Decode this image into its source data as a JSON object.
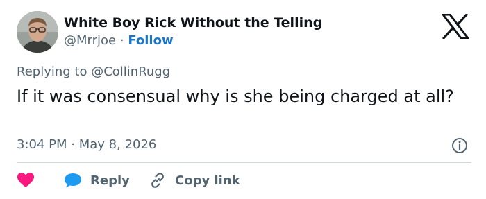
{
  "author": {
    "display_name": "White Boy Rick Without the Telling",
    "handle": "@Mrrjoe",
    "separator": "·",
    "follow_label": "Follow"
  },
  "tweet": {
    "replying_to": "Replying to @CollinRugg",
    "text": "If it was consensual why is she being charged at all?",
    "time": "3:04 PM",
    "meta_separator": "·",
    "date": "May 8, 2026"
  },
  "actions": {
    "reply_label": "Reply",
    "copy_link_label": "Copy link"
  },
  "icons": {
    "logo": "x-logo-icon",
    "info": "info-icon",
    "like": "heart-icon",
    "reply": "speech-bubble-icon",
    "copy": "link-icon"
  },
  "colors": {
    "heart": "#f91880",
    "reply_bubble": "#1d9bf0",
    "follow": "#1d77c9",
    "muted_text": "#536471",
    "primary_text": "#0f1419"
  }
}
